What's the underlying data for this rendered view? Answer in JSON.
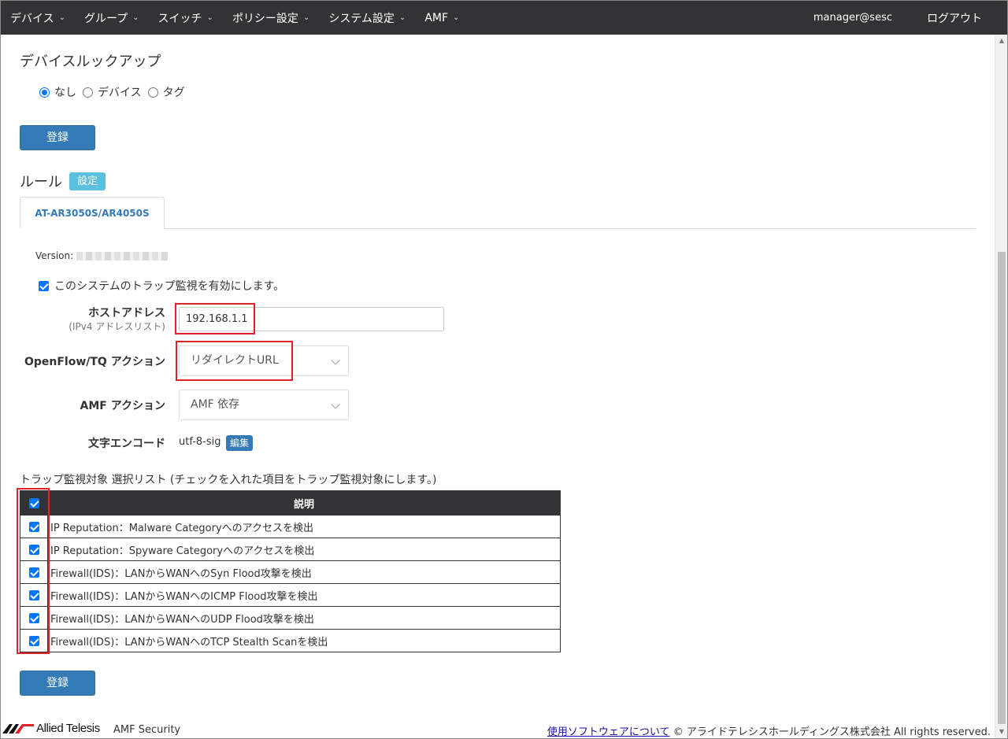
{
  "nav": {
    "items": [
      {
        "label": "デバイス"
      },
      {
        "label": "グループ"
      },
      {
        "label": "スイッチ"
      },
      {
        "label": "ポリシー設定"
      },
      {
        "label": "システム設定"
      },
      {
        "label": "AMF"
      }
    ],
    "user": "manager@sesc",
    "logout": "ログアウト"
  },
  "lookup": {
    "title": "デバイスルックアップ",
    "options": [
      {
        "label": "なし",
        "selected": true
      },
      {
        "label": "デバイス",
        "selected": false
      },
      {
        "label": "タグ",
        "selected": false
      }
    ],
    "register_label": "登録"
  },
  "rules": {
    "title": "ルール",
    "settings_label": "設定",
    "tab_label": "AT-AR3050S/AR4050S",
    "version_label": "Version:",
    "enable_label": "このシステムのトラップ監視を有効にします。",
    "host_label": "ホストアドレス",
    "host_sublabel": "(IPv4 アドレスリスト)",
    "host_value": "192.168.1.1",
    "openflow_label": "OpenFlow/TQ アクション",
    "openflow_value": "リダイレクトURL",
    "amf_label": "AMF アクション",
    "amf_value": "AMF 依存",
    "encoding_label": "文字エンコード",
    "encoding_value": "utf-8-sig",
    "edit_label": "編集"
  },
  "trap_list": {
    "title": "トラップ監視対象 選択リスト (チェックを入れた項目をトラップ監視対象にします。)",
    "header": "説明",
    "rows": [
      {
        "text": "IP Reputation：Malware Categoryへのアクセスを検出",
        "checked": true
      },
      {
        "text": "IP Reputation：Spyware Categoryへのアクセスを検出",
        "checked": true
      },
      {
        "text": "Firewall(IDS)：LANからWANへのSyn Flood攻撃を検出",
        "checked": true
      },
      {
        "text": "Firewall(IDS)：LANからWANへのICMP Flood攻撃を検出",
        "checked": true
      },
      {
        "text": "Firewall(IDS)：LANからWANへのUDP Flood攻撃を検出",
        "checked": true
      },
      {
        "text": "Firewall(IDS)：LANからWANへのTCP Stealth Scanを検出",
        "checked": true
      }
    ],
    "register_label": "登録"
  },
  "footer": {
    "brand": "Allied Telesis",
    "product": "AMF Security",
    "link": "使用ソフトウェアについて",
    "copyright": "© アライドテレシスホールディングス株式会社 All rights reserved."
  },
  "colors": {
    "navbar": "#333335",
    "primary": "#337ab7",
    "info": "#5bc0de",
    "highlight": "#e0232a",
    "checkbox": "#0075ff"
  }
}
